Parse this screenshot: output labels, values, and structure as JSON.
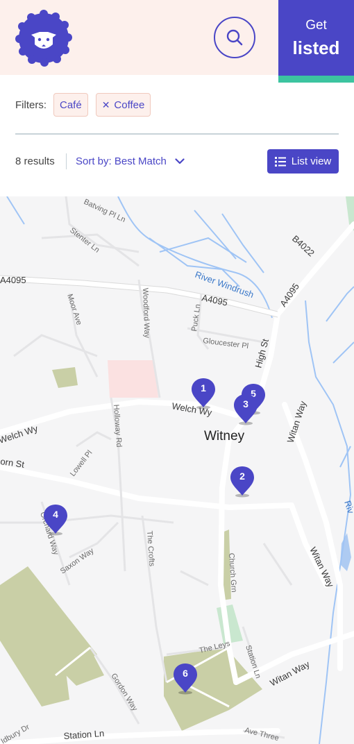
{
  "header": {
    "get_listed_line1": "Get",
    "get_listed_line2": "listed",
    "logo_icon": "sheep-icon",
    "search_icon": "search-icon"
  },
  "filters": {
    "label": "Filters:",
    "chips": [
      {
        "label": "Café",
        "removable": false
      },
      {
        "label": "Coffee",
        "removable": true
      }
    ]
  },
  "results": {
    "count": "8 results",
    "sort_label": "Sort by: Best Match",
    "list_view_label": "List view"
  },
  "map": {
    "town": "Witney",
    "roads": [
      "A4095",
      "A4095",
      "A4095",
      "B4022",
      "High St",
      "Welch Wy",
      "Welch Wy",
      "Witan Way",
      "Witan Way",
      "Witan Way",
      "Station Ln",
      "orn St"
    ],
    "streets": [
      "Batving Pl Ln",
      "Stenter Ln",
      "Moor Ave",
      "Woodford Way",
      "Puck Ln",
      "Gloucester Pl",
      "Holloway Rd",
      "Lowell Pl",
      "Orchard Way",
      "Saxon Way",
      "The Crofts",
      "Church Grn",
      "The Leys",
      "Station Ln",
      "Gordon Way",
      "Ave Three",
      "Idbury Dr"
    ],
    "river": "River Windrush",
    "river_partial": "Riv",
    "pins": [
      "1",
      "2",
      "3",
      "4",
      "5",
      "6"
    ]
  },
  "colors": {
    "brand": "#4a46c6",
    "accent": "#3cc4a0",
    "header_bg": "#fdf0ec"
  }
}
